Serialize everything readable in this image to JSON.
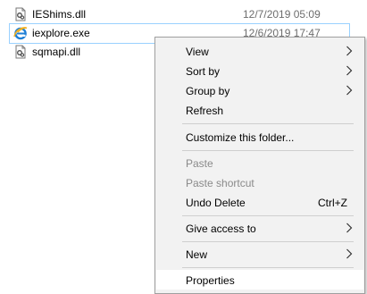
{
  "files": [
    {
      "name": "IEShims.dll",
      "date": "12/7/2019 05:09",
      "icon": "dll-file-icon",
      "selected": false
    },
    {
      "name": "iexplore.exe",
      "date": "12/6/2019 17:47",
      "icon": "internet-explorer-icon",
      "selected": true
    },
    {
      "name": "sqmapi.dll",
      "date": "",
      "icon": "dll-file-icon",
      "selected": false
    }
  ],
  "menu": {
    "view": "View",
    "sort_by": "Sort by",
    "group_by": "Group by",
    "refresh": "Refresh",
    "customize": "Customize this folder...",
    "paste": "Paste",
    "paste_shortcut": "Paste shortcut",
    "undo_delete": "Undo Delete",
    "undo_delete_shortcut": "Ctrl+Z",
    "give_access": "Give access to",
    "new": "New",
    "properties": "Properties"
  },
  "colors": {
    "menu_background": "#f2f2f2",
    "menu_border": "#a0a0a0",
    "disabled_text": "#8a8a8a",
    "hover_background": "#ffffff",
    "selection_border": "#99d1ff",
    "date_text": "#6d6d6d"
  }
}
